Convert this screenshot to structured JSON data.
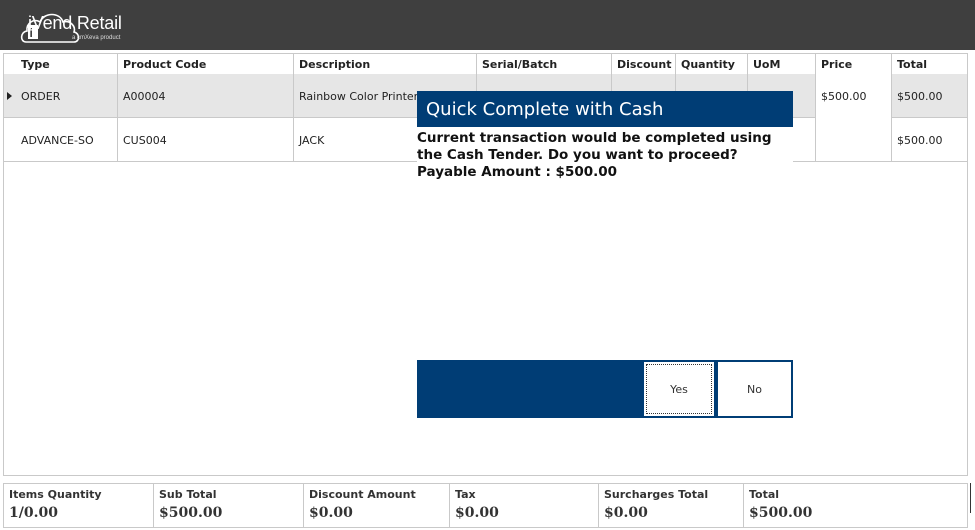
{
  "app": {
    "brand": "iVend Retail",
    "brand_sub": "a cmXeva product"
  },
  "grid": {
    "columns": [
      "Type",
      "Product Code",
      "Description",
      "Serial/Batch",
      "Discount",
      "Quantity",
      "UoM",
      "Price",
      "Total"
    ],
    "rows": [
      {
        "type": "ORDER",
        "product_code": "A00004",
        "description": "Rainbow Color Printer S",
        "serial": "",
        "discount": "",
        "quantity": "",
        "uom": "",
        "price": "$500.00",
        "total": "$500.00"
      },
      {
        "type": "ADVANCE-SO",
        "product_code": "CUS004",
        "description": "JACK",
        "serial": "",
        "discount": "",
        "quantity": "",
        "uom": "",
        "price": "",
        "total": "$500.00"
      }
    ]
  },
  "summary": {
    "items": [
      {
        "label": "Items Quantity",
        "value": "1/0.00"
      },
      {
        "label": "Sub Total",
        "value": "$500.00"
      },
      {
        "label": "Discount Amount",
        "value": "$0.00"
      },
      {
        "label": "Tax",
        "value": "$0.00"
      },
      {
        "label": "Surcharges Total",
        "value": "$0.00"
      },
      {
        "label": "Total",
        "value": "$500.00"
      }
    ]
  },
  "dialog": {
    "title": "Quick Complete with Cash",
    "message": "Current transaction would be completed using the Cash Tender. Do you want to proceed? Payable Amount : $500.00",
    "yes_label": "Yes",
    "no_label": "No"
  },
  "colors": {
    "header_bg": "#3f3f3f",
    "dialog_blue": "#003d75",
    "selected_row": "#e6e6e6"
  }
}
